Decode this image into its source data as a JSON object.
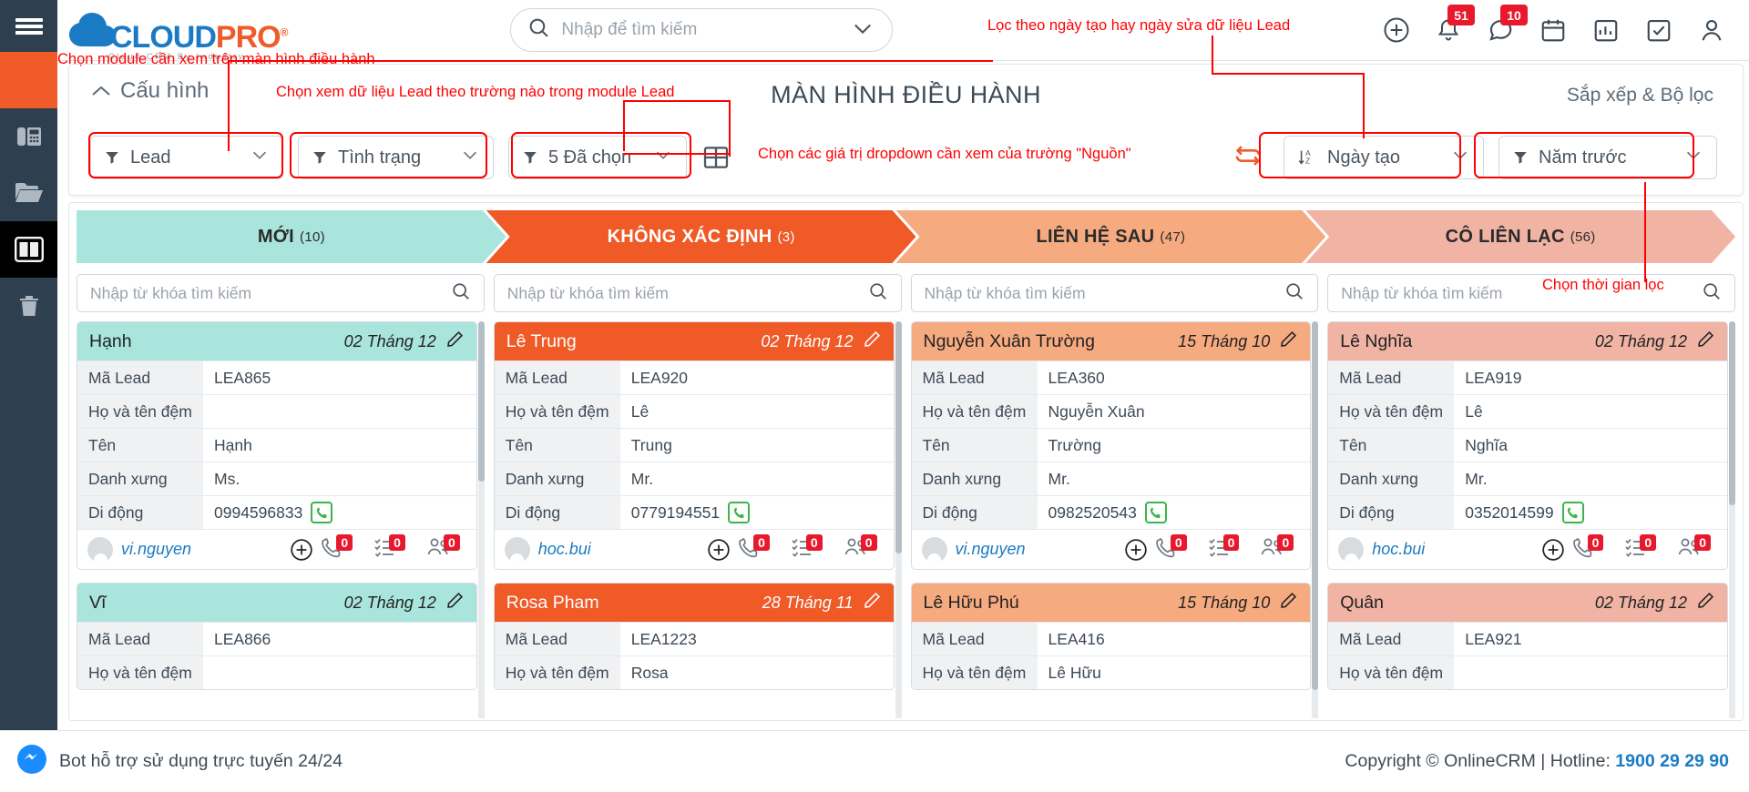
{
  "app": {
    "logo": {
      "part1": "CLOUD",
      "part2": "PRO",
      "registered": "®",
      "tagline": "Cloud CRM By Industry"
    },
    "search": {
      "placeholder": "Nhập để tìm kiếm",
      "value": ""
    },
    "header_icons": [
      {
        "name": "add-icon",
        "badge": null
      },
      {
        "name": "bell-icon",
        "badge": "51"
      },
      {
        "name": "chat-icon",
        "badge": "10"
      },
      {
        "name": "calendar-icon",
        "badge": null
      },
      {
        "name": "chart-icon",
        "badge": null
      },
      {
        "name": "task-icon",
        "badge": null
      },
      {
        "name": "user-icon",
        "badge": null
      }
    ]
  },
  "sidebar": {
    "items": [
      {
        "name": "menu-toggle",
        "icon": "hamburger-icon"
      },
      {
        "name": "sidebar-item-accent",
        "icon": "blank-icon"
      },
      {
        "name": "sidebar-item-pbx",
        "icon": "desk-phone-icon"
      },
      {
        "name": "sidebar-item-files",
        "icon": "folder-icon"
      },
      {
        "name": "sidebar-item-kanban",
        "icon": "kanban-board-icon"
      },
      {
        "name": "sidebar-item-trash",
        "icon": "trash-icon"
      }
    ]
  },
  "config": {
    "toggle_label": "Cấu hình",
    "title": "MÀN HÌNH ĐIỀU HÀNH",
    "sort_filter_label": "Sắp xếp & Bộ lọc",
    "module_dropdown": "Lead",
    "status_dropdown": "Tình trạng",
    "selected_dropdown": "5 Đã chọn",
    "date_sort_dropdown": "Ngày tạo",
    "period_dropdown": "Năm trước"
  },
  "annotations": [
    {
      "id": "a1",
      "text": "Chọn module cần xem trên màn hình điều hành"
    },
    {
      "id": "a2",
      "text": "Chọn xem dữ liệu Lead theo trường nào trong module Lead"
    },
    {
      "id": "a3",
      "text": "Chọn các giá trị dropdown cần xem của trường \"Nguồn\""
    },
    {
      "id": "a4",
      "text": "Lọc theo ngày tạo hay ngày sửa dữ liệu Lead"
    },
    {
      "id": "a5",
      "text": "Chọn thời gian lọc"
    }
  ],
  "board": {
    "column_search_placeholder": "Nhập từ khóa tìm kiếm",
    "stages": [
      {
        "label": "MỚI",
        "count": "(10)",
        "color": "#a9e5dc",
        "text_color": "#2b2b2b"
      },
      {
        "label": "KHÔNG XÁC ĐỊNH",
        "count": "(3)",
        "color": "#ef5a27",
        "text_color": "#ffffff"
      },
      {
        "label": "LIÊN HỆ SAU",
        "count": "(47)",
        "color": "#f6aa80",
        "text_color": "#2b2b2b"
      },
      {
        "label": "CÔ LIÊN LẠC",
        "count": "(56)",
        "color": "#f0b3a4",
        "text_color": "#2b2b2b"
      }
    ],
    "field_labels": {
      "code": "Mã Lead",
      "lastname": "Họ và tên đệm",
      "firstname": "Tên",
      "salutation": "Danh xưng",
      "mobile": "Di động"
    },
    "columns": [
      {
        "stage": "MỚI",
        "head_bg": "#a9e5dc",
        "head_color": "#222222",
        "cards": [
          {
            "name": "Hạnh",
            "date": "02 Tháng 12",
            "code": "LEA865",
            "lastname": "",
            "firstname": "Hạnh",
            "salutation": "Ms.",
            "mobile": "0994596833",
            "owner": "vi.nguyen",
            "calls": "0",
            "tasks": "0",
            "contacts": "0"
          },
          {
            "name": "Vĩ",
            "date": "02 Tháng 12",
            "code": "LEA866",
            "lastname": "",
            "firstname": "",
            "salutation": "",
            "mobile": "",
            "owner": "",
            "calls": "",
            "tasks": "",
            "contacts": ""
          }
        ]
      },
      {
        "stage": "KHÔNG XÁC ĐỊNH",
        "head_bg": "#ef5a27",
        "head_color": "#ffffff",
        "cards": [
          {
            "name": "Lê Trung",
            "date": "02 Tháng 12",
            "code": "LEA920",
            "lastname": "Lê",
            "firstname": "Trung",
            "salutation": "Mr.",
            "mobile": "0779194551",
            "owner": "hoc.bui",
            "calls": "0",
            "tasks": "0",
            "contacts": "0"
          },
          {
            "name": "Rosa Pham",
            "date": "28 Tháng 11",
            "code": "LEA1223",
            "lastname": "Rosa",
            "firstname": "",
            "salutation": "",
            "mobile": "",
            "owner": "",
            "calls": "",
            "tasks": "",
            "contacts": ""
          }
        ]
      },
      {
        "stage": "LIÊN HỆ SAU",
        "head_bg": "#f6aa80",
        "head_color": "#222222",
        "cards": [
          {
            "name": "Nguyễn Xuân Trường",
            "date": "15 Tháng 10",
            "code": "LEA360",
            "lastname": "Nguyễn Xuân",
            "firstname": "Trường",
            "salutation": "Mr.",
            "mobile": "0982520543",
            "owner": "vi.nguyen",
            "calls": "0",
            "tasks": "0",
            "contacts": "0"
          },
          {
            "name": "Lê Hữu Phú",
            "date": "15 Tháng 10",
            "code": "LEA416",
            "lastname": "Lê Hữu",
            "firstname": "",
            "salutation": "",
            "mobile": "",
            "owner": "",
            "calls": "",
            "tasks": "",
            "contacts": ""
          }
        ]
      },
      {
        "stage": "CÔ LIÊN LẠC",
        "head_bg": "#f0b3a4",
        "head_color": "#222222",
        "cards": [
          {
            "name": "Lê Nghĩa",
            "date": "02 Tháng 12",
            "code": "LEA919",
            "lastname": "Lê",
            "firstname": "Nghĩa",
            "salutation": "Mr.",
            "mobile": "0352014599",
            "owner": "hoc.bui",
            "calls": "0",
            "tasks": "0",
            "contacts": "0"
          },
          {
            "name": "Quân",
            "date": "02 Tháng 12",
            "code": "LEA921",
            "lastname": "",
            "firstname": "",
            "salutation": "",
            "mobile": "",
            "owner": "",
            "calls": "",
            "tasks": "",
            "contacts": ""
          }
        ]
      }
    ]
  },
  "footer": {
    "bot_label": "Bot hỗ trợ sử dụng trực tuyến 24/24",
    "copyright": "Copyright © OnlineCRM | Hotline: ",
    "hotline": "1900 29 29 90"
  },
  "colors": {
    "accent": "#f15a29",
    "brand_blue": "#1a7bc4",
    "badge_red": "#e8192c",
    "sidebar": "#2e3f50"
  }
}
